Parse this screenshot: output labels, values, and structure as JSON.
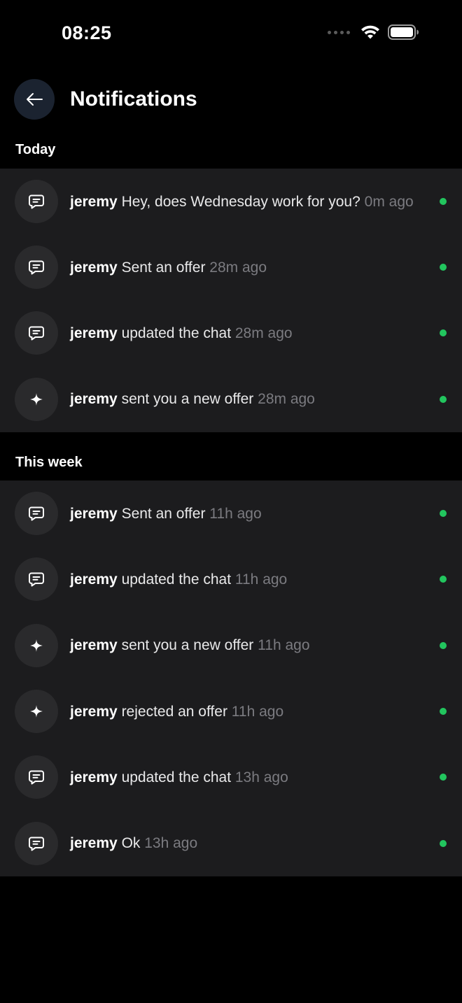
{
  "status_bar": {
    "time": "08:25"
  },
  "header": {
    "title": "Notifications",
    "back_icon": "arrow-left-icon"
  },
  "sections": {
    "today": {
      "label": "Today",
      "items": [
        {
          "user": "jeremy",
          "message": "Hey, does Wednesday work for you?",
          "time": "0m ago",
          "icon": "chat-icon",
          "unread": true
        },
        {
          "user": "jeremy",
          "message": "Sent an offer",
          "time": "28m ago",
          "icon": "chat-icon",
          "unread": true
        },
        {
          "user": "jeremy",
          "message": "updated the chat",
          "time": "28m ago",
          "icon": "chat-icon",
          "unread": true
        },
        {
          "user": "jeremy",
          "message": "sent you a new offer",
          "time": "28m ago",
          "icon": "sparkle-icon",
          "unread": true
        }
      ]
    },
    "this_week": {
      "label": "This week",
      "items": [
        {
          "user": "jeremy",
          "message": "Sent an offer",
          "time": "11h ago",
          "icon": "chat-icon",
          "unread": true
        },
        {
          "user": "jeremy",
          "message": "updated the chat",
          "time": "11h ago",
          "icon": "chat-icon",
          "unread": true
        },
        {
          "user": "jeremy",
          "message": "sent you a new offer",
          "time": "11h ago",
          "icon": "sparkle-icon",
          "unread": true
        },
        {
          "user": "jeremy",
          "message": "rejected an offer",
          "time": "11h ago",
          "icon": "sparkle-icon",
          "unread": true
        },
        {
          "user": "jeremy",
          "message": "updated the chat",
          "time": "13h ago",
          "icon": "chat-icon",
          "unread": true
        },
        {
          "user": "jeremy",
          "message": "Ok",
          "time": "13h ago",
          "icon": "chat-icon",
          "unread": true
        }
      ]
    }
  },
  "colors": {
    "background": "#000000",
    "list_background": "#1c1c1e",
    "avatar_background": "#2a2a2c",
    "back_button_background": "#1b2330",
    "unread_dot": "#22c55e",
    "muted_text": "#7b7b80"
  }
}
